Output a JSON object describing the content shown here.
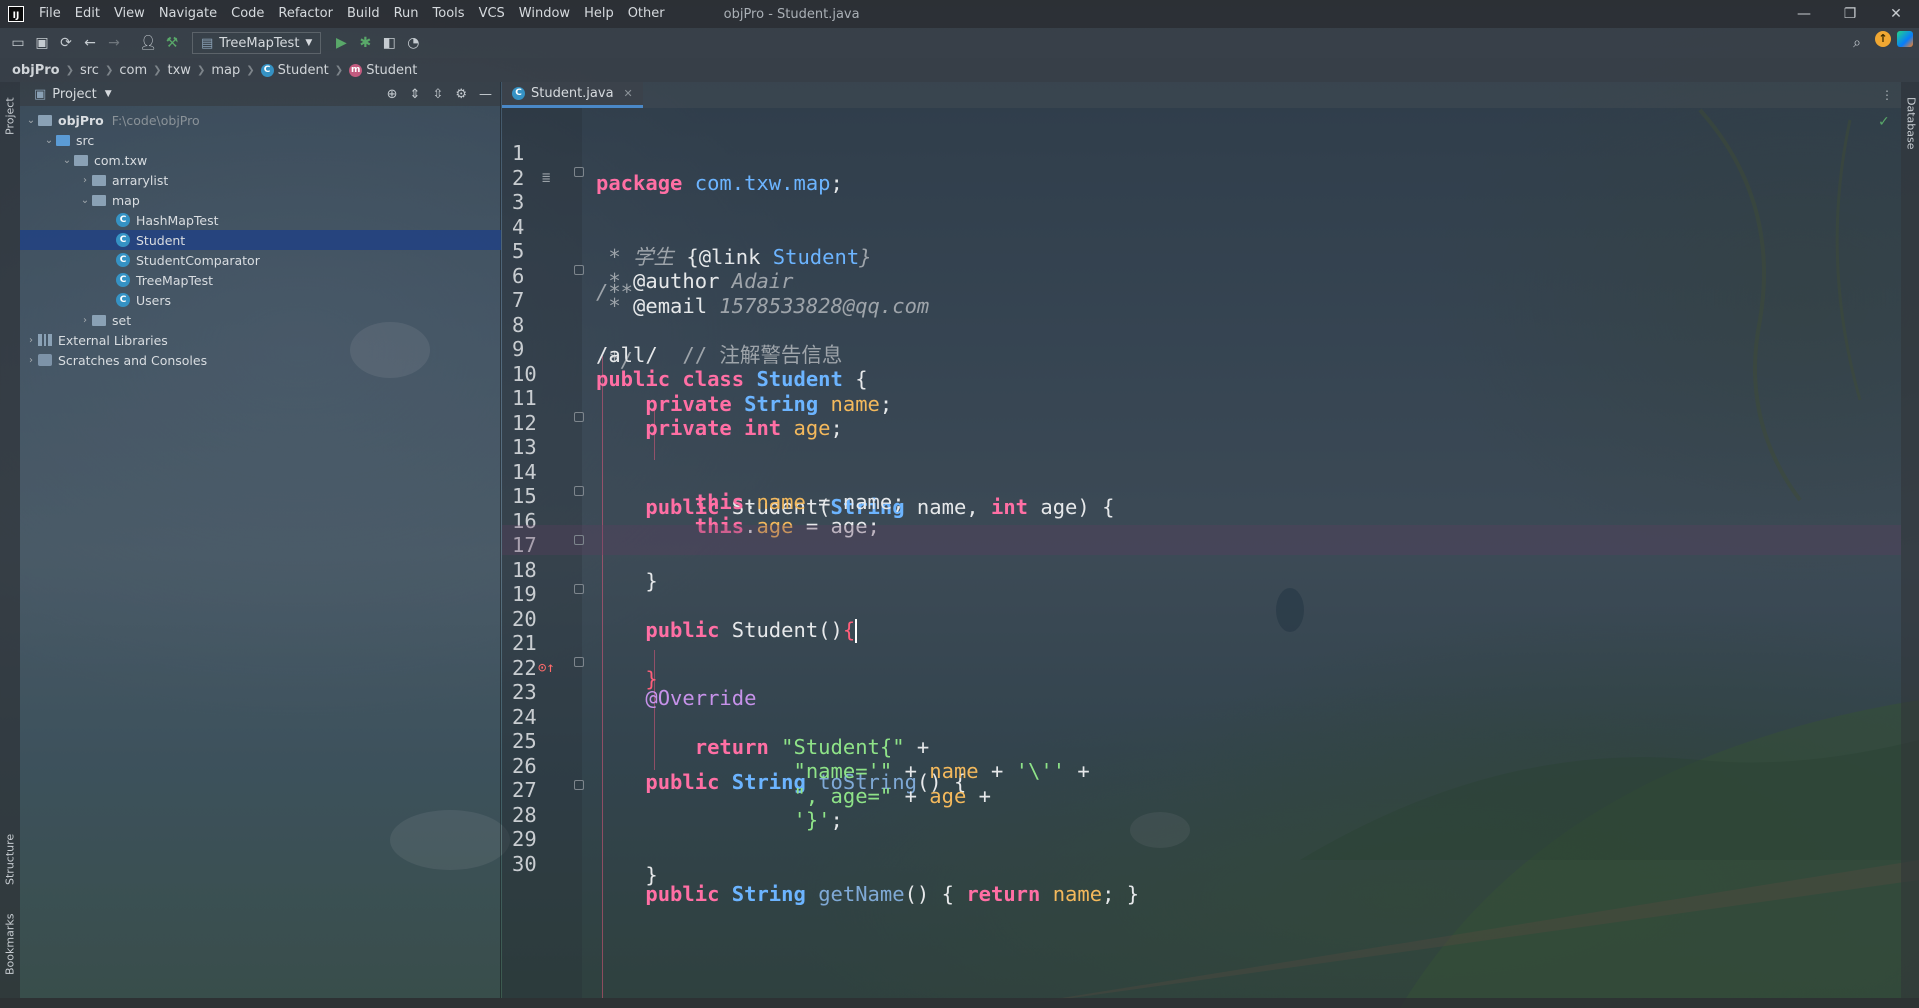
{
  "menubar": {
    "logo": "IJ",
    "items": [
      "File",
      "Edit",
      "View",
      "Navigate",
      "Code",
      "Refactor",
      "Build",
      "Run",
      "Tools",
      "VCS",
      "Window",
      "Help",
      "Other"
    ],
    "window_title": "objPro - Student.java",
    "minimize": "—",
    "restore": "❐",
    "close": "✕"
  },
  "toolbar": {
    "run_config": "TreeMapTest"
  },
  "breadcrumb": {
    "items": [
      "objPro",
      "src",
      "com",
      "txw",
      "map",
      "Student",
      "Student"
    ]
  },
  "left_strip": {
    "project": "Project",
    "structure": "Structure",
    "bookmarks": "Bookmarks"
  },
  "right_strip": {
    "database": "Database"
  },
  "project_panel": {
    "title": "Project",
    "tree": [
      {
        "label": "objPro",
        "path": "F:\\code\\objPro"
      },
      {
        "label": "src"
      },
      {
        "label": "com.txw"
      },
      {
        "label": "arrarylist"
      },
      {
        "label": "map"
      },
      {
        "label": "HashMapTest"
      },
      {
        "label": "Student"
      },
      {
        "label": "StudentComparator"
      },
      {
        "label": "TreeMapTest"
      },
      {
        "label": "Users"
      },
      {
        "label": "set"
      },
      {
        "label": "External Libraries"
      },
      {
        "label": "Scratches and Consoles"
      }
    ]
  },
  "editor": {
    "tab": "Student.java",
    "lines": [
      {
        "n": "1"
      },
      {
        "n": "2"
      },
      {
        "n": "3"
      },
      {
        "n": "4"
      },
      {
        "n": "5"
      },
      {
        "n": "6"
      },
      {
        "n": "7"
      },
      {
        "n": "8"
      },
      {
        "n": "9"
      },
      {
        "n": "10"
      },
      {
        "n": "11"
      },
      {
        "n": "12"
      },
      {
        "n": "13"
      },
      {
        "n": "14"
      },
      {
        "n": "15"
      },
      {
        "n": "16"
      },
      {
        "n": "17"
      },
      {
        "n": "18"
      },
      {
        "n": "19"
      },
      {
        "n": "20"
      },
      {
        "n": "21"
      },
      {
        "n": "22"
      },
      {
        "n": "23"
      },
      {
        "n": "24"
      },
      {
        "n": "25"
      },
      {
        "n": "26"
      },
      {
        "n": "27"
      },
      {
        "n": "28"
      },
      {
        "n": "29"
      },
      {
        "n": "30"
      }
    ],
    "code": {
      "l1_kw": "package",
      "l1_pkg": "com.txw.map",
      "l1_end": ";",
      "l3": "/**",
      "l4_a": " * 学生 ",
      "l4_b": "{@link ",
      "l4_c": "Student",
      "l4_d": "}",
      "l5_a": " * ",
      "l5_b": "@author",
      "l5_c": " Adair",
      "l6_a": " * ",
      "l6_b": "@email",
      "l6_c": " 1578533828@qq.com",
      "l7": " */",
      "l8_a": "/all/  ",
      "l8_b": "// 注解警告信息",
      "l9_a": "public class ",
      "l9_b": "Student",
      "l9_c": " {",
      "l10_a": "private ",
      "l10_b": "String ",
      "l10_c": "name",
      "l10_d": ";",
      "l11_a": "private int ",
      "l11_c": "age",
      "l11_d": ";",
      "l13_a": "public ",
      "l13_b": "Student(",
      "l13_c": "String",
      "l13_d": " name, ",
      "l13_e": "int",
      "l13_f": " age) {",
      "l14_a": "this",
      "l14_b": ".",
      "l14_c": "name",
      "l14_d": " = name;",
      "l15_a": "this",
      "l15_b": ".",
      "l15_c": "age",
      "l15_d": " = age;",
      "l16": "}",
      "l18_a": "public ",
      "l18_b": "Student()",
      "l18_c": "{",
      "l20": "}",
      "l22": "@Override",
      "l23_a": "public ",
      "l23_b": "String ",
      "l23_c": "toString",
      "l23_d": "() {",
      "l24_a": "return ",
      "l24_b": "\"Student{\"",
      "l24_c": " +",
      "l25_a": "\"name='\"",
      "l25_b": " + ",
      "l25_c": "name",
      "l25_d": " + ",
      "l25_e": "'\\''",
      "l25_f": " +",
      "l26_a": "\", age=\"",
      "l26_b": " + ",
      "l26_c": "age",
      "l26_d": " +",
      "l27_a": "'}'",
      "l27_b": ";",
      "l28": "}",
      "l30_a": "public ",
      "l30_b": "String ",
      "l30_c": "getName",
      "l30_d": "() { ",
      "l30_e": "return ",
      "l30_f": "name",
      "l30_g": "; }"
    }
  },
  "colors": {
    "keyword": "#ff6fa4",
    "type": "#6cb4ff",
    "string": "#8fe388",
    "field": "#f4b95c",
    "selection": "#214283"
  }
}
